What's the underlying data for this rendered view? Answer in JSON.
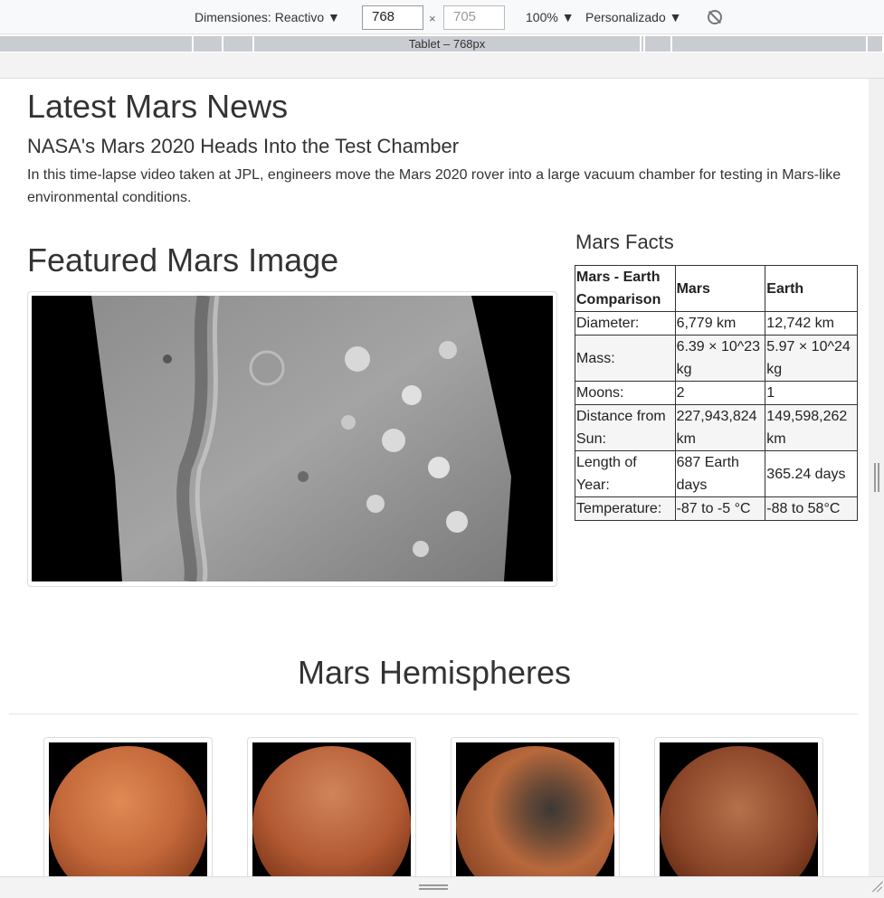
{
  "devtools": {
    "dimensions_label": "Dimensiones: Reactivo ▼",
    "width_value": "768",
    "times": "×",
    "height_placeholder": "705",
    "zoom_label": "100% ▼",
    "throttle_label": "Personalizado ▼",
    "media_query_label": "Tablet – 768px",
    "rotate_icon": "rotate-icon"
  },
  "news": {
    "section_title": "Latest Mars News",
    "headline": "NASA's Mars 2020 Heads Into the Test Chamber",
    "teaser": "In this time-lapse video taken at JPL, engineers move the Mars 2020 rover into a large vacuum chamber for testing in Mars-like environmental conditions."
  },
  "featured": {
    "section_title": "Featured Mars Image"
  },
  "facts": {
    "title": "Mars Facts",
    "headers": [
      "Mars - Earth Comparison",
      "Mars",
      "Earth"
    ],
    "rows": [
      [
        "Diameter:",
        "6,779 km",
        "12,742 km"
      ],
      [
        "Mass:",
        "6.39 × 10^23 kg",
        "5.97 × 10^24 kg"
      ],
      [
        "Moons:",
        "2",
        "1"
      ],
      [
        "Distance from Sun:",
        "227,943,824 km",
        "149,598,262 km"
      ],
      [
        "Length of Year:",
        "687 Earth days",
        "365.24 days"
      ],
      [
        "Temperature:",
        "-87 to -5 °C",
        "-88 to 58°C"
      ]
    ]
  },
  "hemispheres": {
    "title": "Mars Hemispheres",
    "colors": [
      "#c4693a",
      "#b35a33",
      "#a85a35",
      "#8a4428"
    ]
  }
}
